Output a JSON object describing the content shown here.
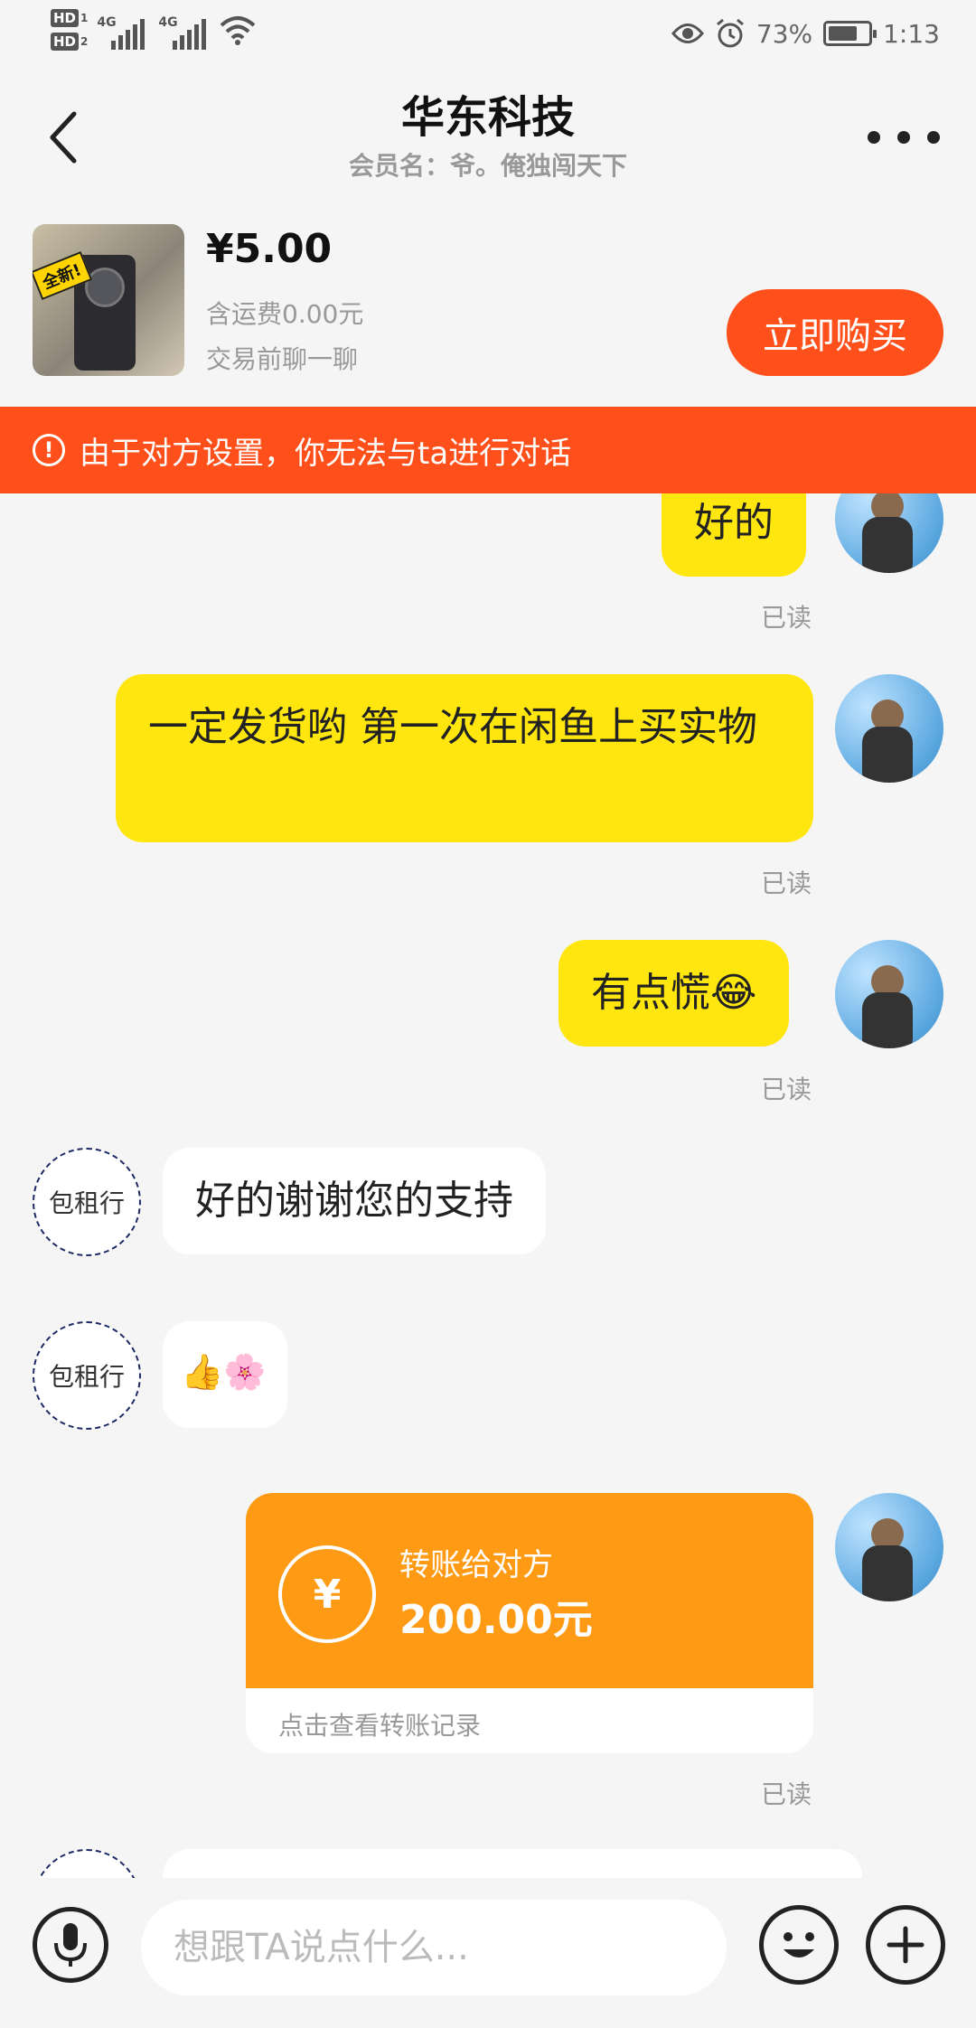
{
  "status_bar": {
    "hd1": "HD",
    "hd1_num": "1",
    "hd2": "HD",
    "hd2_num": "2",
    "net1": "4G",
    "net2": "4G",
    "battery_pct": "73%",
    "battery_level": 0.73,
    "time": "1:13"
  },
  "header": {
    "title": "华东科技",
    "subtitle": "会员名：爷。俺独闯天下"
  },
  "product": {
    "price": "¥5.00",
    "shipping": "含运费0.00元",
    "chat_hint": "交易前聊一聊",
    "buy_label": "立即购买",
    "thumb_tag": "全新!"
  },
  "banner": {
    "icon": "!",
    "text": "由于对方设置，你无法与ta进行对话"
  },
  "messages": {
    "m1": "好的",
    "m1_read": "已读",
    "m2": "一定发货哟 第一次在闲鱼上买实物",
    "m2_read": "已读",
    "m3": "有点慌",
    "m3_emoji": "😂",
    "m3_read": "已读",
    "m4": "好的谢谢您的支持",
    "m5_emoji": "👍🌸",
    "shop_avatar_label": "包租行",
    "transfer_label": "转账给对方",
    "transfer_amount": "200.00元",
    "transfer_link": "点击查看转账记录",
    "transfer_read": "已读"
  },
  "input": {
    "placeholder": "想跟TA说点什么..."
  }
}
